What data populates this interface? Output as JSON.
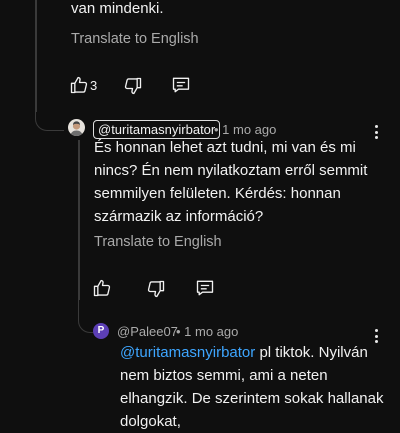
{
  "parent_comment": {
    "text_tail": "van mindenki.",
    "translate_label": "Translate to English",
    "like_count": "3"
  },
  "reply1": {
    "author": "@turitamasnyirbator",
    "time": "• 1 mo ago",
    "text": "És honnan lehet azt tudni, mi van és mi nincs? Én nem nyilatkoztam erről semmit semmilyen felületen. Kérdés: honnan származik az információ?",
    "translate_label": "Translate to English"
  },
  "reply2": {
    "avatar_letter": "P",
    "author": "@Palee07",
    "time": "• 1 mo ago",
    "mention": "@turitamasnyirbator",
    "text_after_mention": " pl tiktok. Nyilván nem biztos semmi, ami a neten elhangzik. De szerintem sokak hallanak dolgokat,"
  },
  "colors": {
    "background": "#0f0f0f",
    "text": "#f1f1f1",
    "muted": "#aaaaaa",
    "mention": "#3ea6ff",
    "avatar_purple": "#5c3fb5"
  },
  "icons": [
    "like-icon",
    "dislike-icon",
    "reply-icon",
    "more-options-icon"
  ]
}
